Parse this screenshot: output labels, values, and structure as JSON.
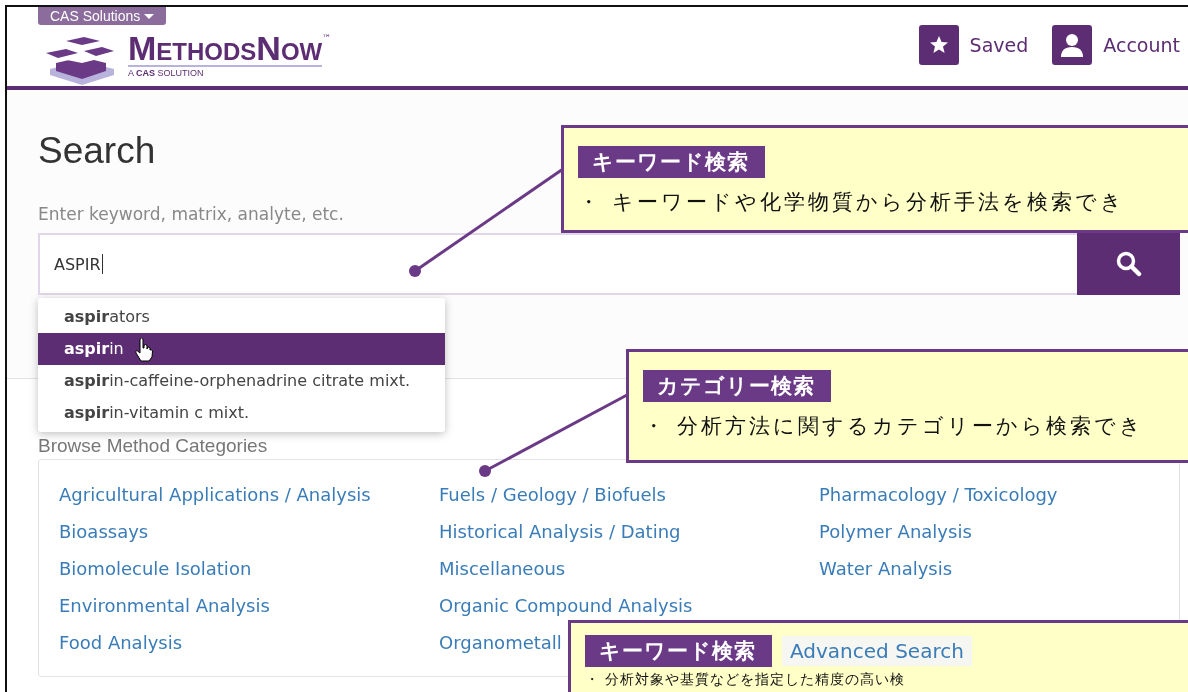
{
  "header": {
    "solutions_menu": "CAS Solutions",
    "logo": {
      "name": "MethodsNow",
      "tm": "™",
      "tagline": "A **CAS** SOLUTION"
    },
    "actions": [
      {
        "kind": "star",
        "label": "Saved"
      },
      {
        "kind": "person",
        "label": "Account"
      }
    ]
  },
  "search": {
    "title": "Search",
    "label": "Enter keyword, matrix, analyte, etc.",
    "value": "ASPIR",
    "suggestions": [
      {
        "text": "**aspir**ators",
        "selected": false
      },
      {
        "text": "**aspir**in",
        "selected": true
      },
      {
        "text": "**aspir**in-caffeine-orphenadrine citrate mixt.",
        "selected": false
      },
      {
        "text": "**aspir**in-vitamin c mixt.",
        "selected": false
      }
    ]
  },
  "categories": {
    "heading": "Browse Method Categories",
    "columns": [
      [
        "Agricultural Applications / Analysis",
        "Bioassays",
        "Biomolecule Isolation",
        "Environmental Analysis",
        "Food Analysis"
      ],
      [
        "Fuels / Geology / Biofuels",
        "Historical Analysis / Dating",
        "Miscellaneous",
        "Organic Compound Analysis",
        "Organometall"
      ],
      [
        "Pharmacology / Toxicology",
        "Polymer Analysis",
        "Water Analysis"
      ]
    ]
  },
  "callouts": [
    {
      "tag": "キーワード検索",
      "text": "・ キーワードや化学物質から分析手法を検索でき"
    },
    {
      "tag": "カテゴリー検索",
      "text": "・ 分析方法に関するカテゴリーから検索でき"
    },
    {
      "tag": "キーワード検索",
      "link": "Advanced Search",
      "text": "・ 分析対象や基質などを指定した精度の高い検"
    }
  ]
}
